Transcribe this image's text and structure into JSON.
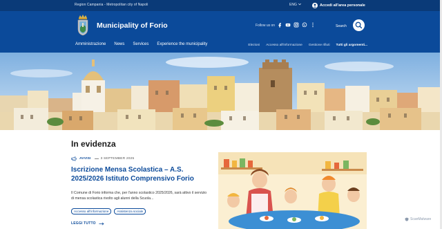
{
  "top_bar": {
    "region": "Region Campania - Metropolitan city of Napoli",
    "language": "ENG",
    "login_label": "Accedi all'area personale"
  },
  "header": {
    "title": "Municipality of Forio",
    "follow_label": "Follow us on",
    "social_icons": [
      "facebook-icon",
      "youtube-icon",
      "instagram-icon",
      "whatsapp-icon",
      "more-icon"
    ],
    "search_label": "Search"
  },
  "nav": {
    "main": [
      "Amministrazione",
      "News",
      "Services",
      "Experience the municipality"
    ],
    "secondary": [
      "Elezioni",
      "Accesso all'informazione",
      "Gestione rifiuti",
      "Tutti gli argomenti..."
    ]
  },
  "section": {
    "title": "In evidenza"
  },
  "article": {
    "type": "AVVISI",
    "date": "3 SEPTEMBER 2025",
    "headline": "Iscrizione Mensa Scolastica – A.S. 2025/2026 Istituto Comprensivo Forio",
    "excerpt": "Il Comune di Forio informa che, per l'anno scolastico 2025/2026, sarà attivo il servizio di mensa scolastica rivolto agli alunni della Scuola...",
    "tags": [
      "Accesso all'informazione",
      "Assistenza sociale"
    ],
    "read_more": "LEGGI TUTTO"
  },
  "watermark": "ScanMalware",
  "colors": {
    "primary": "#0b4a9a",
    "top_bar": "#0a3a78"
  }
}
